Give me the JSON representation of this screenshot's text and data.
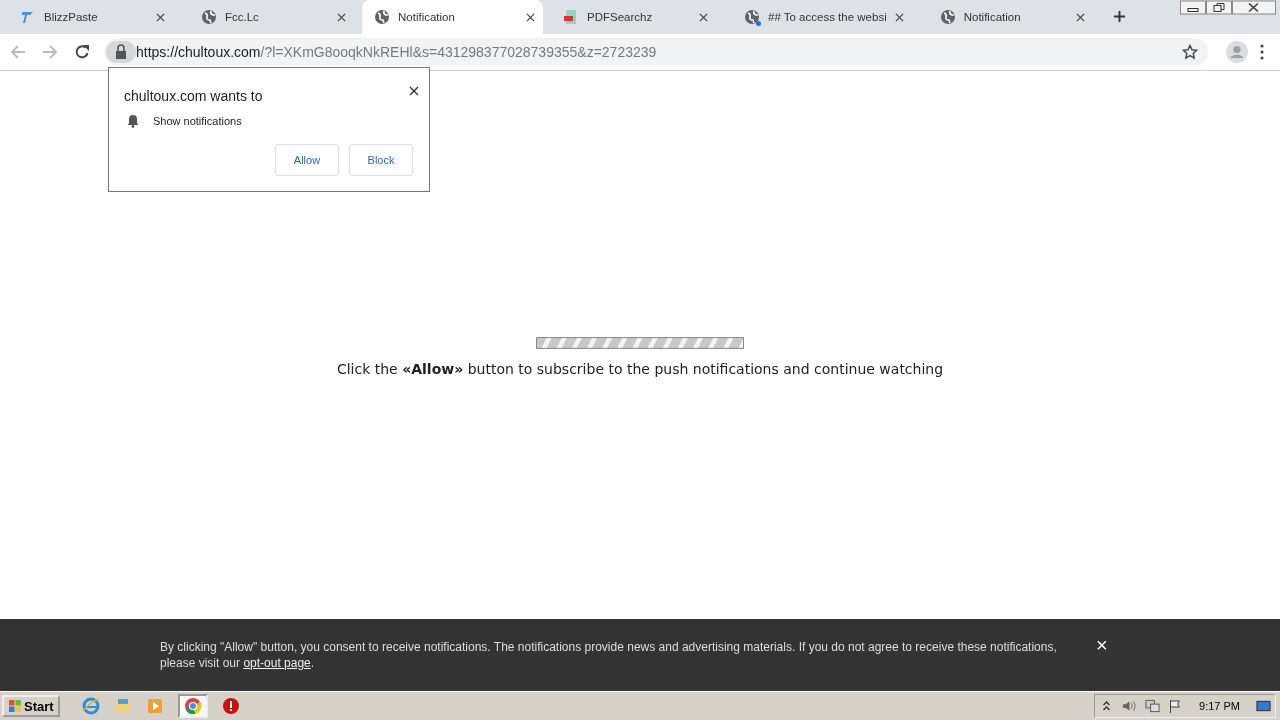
{
  "tabs": [
    {
      "title": "BlizzPaste",
      "kind": "logo",
      "selected": false,
      "badge": false
    },
    {
      "title": "Fcc.Lc",
      "kind": "globe",
      "selected": false,
      "badge": false
    },
    {
      "title": "Notification",
      "kind": "globe",
      "selected": true,
      "badge": false
    },
    {
      "title": "PDFSearchz",
      "kind": "document",
      "selected": false,
      "badge": false
    },
    {
      "title": "## To access the websi",
      "kind": "globe",
      "selected": false,
      "badge": true
    },
    {
      "title": "Notification",
      "kind": "globe",
      "selected": false,
      "badge": false
    }
  ],
  "address": {
    "host": "https://chultoux.com",
    "rest": "/?l=XKmG8ooqkNkREHl&s=431298377028739355&z=2723239"
  },
  "permission_popup": {
    "title": "chultoux.com wants to",
    "permission": "Show notifications",
    "buttons": [
      "Allow",
      "Block"
    ]
  },
  "page": {
    "message_before": "Click the ",
    "message_bold": "«Allow»",
    "message_after": " button to subscribe to the push notifications and continue watching"
  },
  "consent_banner": {
    "text": "By clicking \"Allow\" button, you consent to receive notifications. The notifications provide news and advertising materials. If you do not agree to receive these notifications, please visit our ",
    "link": "opt-out page",
    "text_end": ".",
    "close": "×"
  },
  "taskbar": {
    "start": "Start",
    "clock": "9:17 PM"
  }
}
